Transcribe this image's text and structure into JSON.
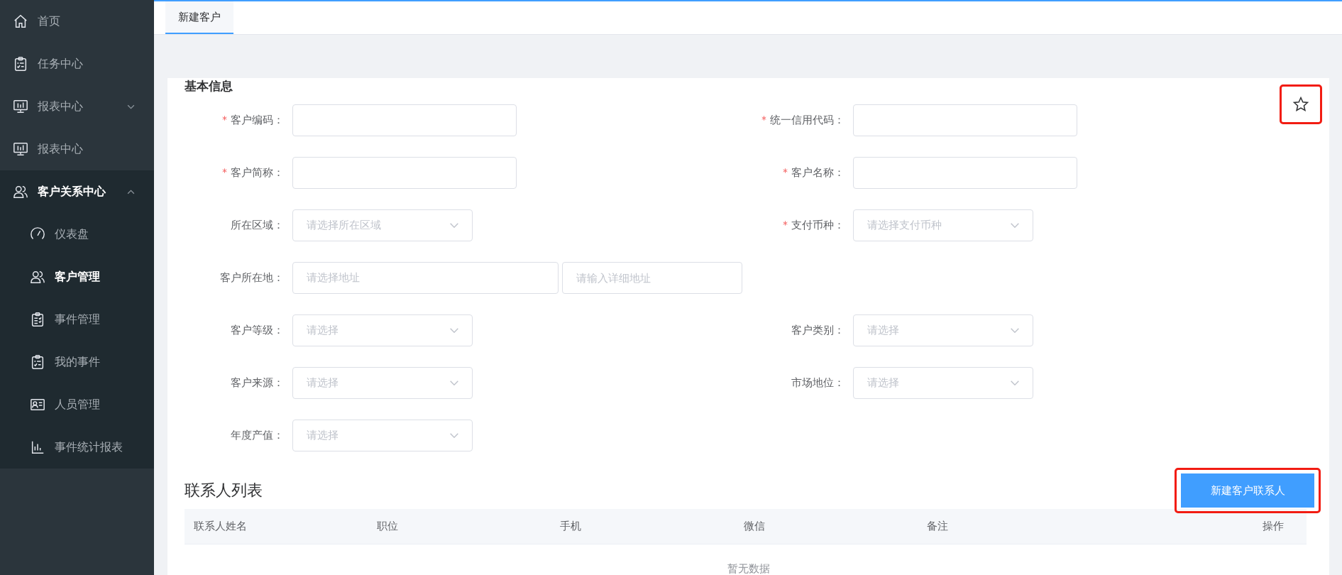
{
  "sidebar": {
    "items": [
      {
        "label": "首页"
      },
      {
        "label": "任务中心"
      },
      {
        "label": "报表中心",
        "expanded": false
      },
      {
        "label": "报表中心"
      },
      {
        "label": "客户关系中心",
        "expanded": true,
        "children": [
          {
            "label": "仪表盘",
            "selected": false
          },
          {
            "label": "客户管理",
            "selected": true
          },
          {
            "label": "事件管理",
            "selected": false
          },
          {
            "label": "我的事件",
            "selected": false
          },
          {
            "label": "人员管理",
            "selected": false
          },
          {
            "label": "事件统计报表",
            "selected": false
          }
        ]
      }
    ]
  },
  "tabs": [
    {
      "label": "新建客户",
      "selected": true
    }
  ],
  "form": {
    "title": "基本信息",
    "rows": [
      [
        {
          "label": "客户编码：",
          "required": true,
          "kind": "text"
        },
        {
          "label": "统一信用代码：",
          "required": true,
          "kind": "text"
        }
      ],
      [
        {
          "label": "客户简称：",
          "required": true,
          "kind": "text"
        },
        {
          "label": "客户名称：",
          "required": true,
          "kind": "text"
        }
      ],
      [
        {
          "label": "所在区域：",
          "required": false,
          "kind": "select",
          "placeholder": "请选择所在区域"
        },
        {
          "label": "支付币种：",
          "required": true,
          "kind": "select",
          "placeholder": "请选择支付币种"
        }
      ],
      [
        {
          "label": "客户所在地：",
          "required": false,
          "kind": "address",
          "placeholder": "请选择地址",
          "placeholder2": "请输入详细地址"
        }
      ],
      [
        {
          "label": "客户等级：",
          "required": false,
          "kind": "select",
          "placeholder": "请选择"
        },
        {
          "label": "客户类别：",
          "required": false,
          "kind": "select",
          "placeholder": "请选择"
        }
      ],
      [
        {
          "label": "客户来源：",
          "required": false,
          "kind": "select",
          "placeholder": "请选择"
        },
        {
          "label": "市场地位：",
          "required": false,
          "kind": "select",
          "placeholder": "请选择"
        }
      ],
      [
        {
          "label": "年度产值：",
          "required": false,
          "kind": "select",
          "placeholder": "请选择"
        }
      ]
    ]
  },
  "contacts": {
    "title": "联系人列表",
    "button": "新建客户联系人",
    "table": {
      "columns": [
        "联系人姓名",
        "职位",
        "手机",
        "微信",
        "备注",
        "操作"
      ],
      "empty_text": "暂无数据"
    }
  }
}
